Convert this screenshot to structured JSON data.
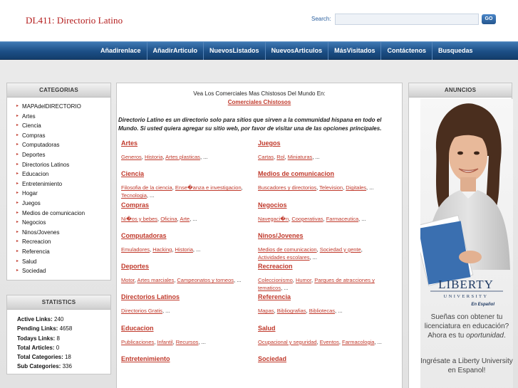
{
  "header": {
    "site_title": "DL411: Directorio Latino",
    "search_label": "Search:",
    "search_value": "",
    "search_button": "GO"
  },
  "nav": {
    "items": [
      "Añadirenlace",
      "AñadirArticulo",
      "NuevosListados",
      "NuevosArticulos",
      "MásVisitados",
      "Contáctenos",
      "Busquedas"
    ]
  },
  "categories": {
    "title": "CATEGORIAS",
    "items": [
      "MAPAdelDIRECTORIO",
      "Artes",
      "Ciencia",
      "Compras",
      "Computadoras",
      "Deportes",
      "Directorios Latinos",
      "Educacion",
      "Entretenimiento",
      "Hogar",
      "Juegos",
      "Medios de comunicacion",
      "Negocios",
      "Ninos/Jovenes",
      "Recreacion",
      "Referencia",
      "Salud",
      "Sociedad"
    ]
  },
  "statistics": {
    "title": "STATISTICS",
    "items": [
      {
        "label": "Active Links:",
        "value": "240"
      },
      {
        "label": "Pending Links:",
        "value": "4658"
      },
      {
        "label": "Todays Links:",
        "value": "8"
      },
      {
        "label": "Total Articles:",
        "value": "0"
      },
      {
        "label": "Total Categories:",
        "value": "18"
      },
      {
        "label": "Sub Categories:",
        "value": "336"
      }
    ]
  },
  "ads": {
    "title": "ANUNCIOS",
    "brand": "LIBERTY",
    "brand_sub": "UNIVERSITY",
    "brand_lang": "En Español",
    "copy_1": "Sueñas con obtener tu licenciatura en educación? Ahora es tu",
    "copy_1_em": "oportunidad",
    "copy_1_end": ".",
    "copy_2": "Ingrésate a Liberty University en Espanol!"
  },
  "main": {
    "promo_line": "Vea Los Comerciales Mas Chistosos Del Mundo En:",
    "promo_link": "Comerciales Chistosos",
    "intro": "Directorio Latino es un directorio solo para sitios que sirven a la communidad hispana en todo el Mundo. Si usted quiera agregar su sitio web, por favor de visitar una de las opciones principales.",
    "left": [
      {
        "title": "Artes",
        "subs": [
          "Generos",
          "Historia",
          "Artes plasticas"
        ],
        "more": "..."
      },
      {
        "title": "Ciencia",
        "subs": [
          "Filosofia de la ciencia",
          "Ense�anza e investigacion",
          "Tecnologia"
        ],
        "more": "..."
      },
      {
        "title": "Compras",
        "subs": [
          "Ni�os y bebes",
          "Oficina",
          "Arte"
        ],
        "more": "..."
      },
      {
        "title": "Computadoras",
        "subs": [
          "Emuladores",
          "Hacking",
          "Historia"
        ],
        "more": "..."
      },
      {
        "title": "Deportes",
        "subs": [
          "Motor",
          "Artes marciales",
          "Campeonatos y torneos"
        ],
        "more": "..."
      },
      {
        "title": "Directorios Latinos",
        "subs": [
          "Directorios Gratis"
        ],
        "more": "..."
      },
      {
        "title": "Educacion",
        "subs": [
          "Publicaciones",
          "Infantil",
          "Recursos"
        ],
        "more": "..."
      },
      {
        "title": "Entretenimiento",
        "subs": [],
        "more": ""
      }
    ],
    "right": [
      {
        "title": "Juegos",
        "subs": [
          "Cartas",
          "Rol",
          "Miniaturas"
        ],
        "more": "..."
      },
      {
        "title": "Medios de comunicacion",
        "subs": [
          "Buscadores y directorios",
          "Television",
          "Digitales"
        ],
        "more": "..."
      },
      {
        "title": "Negocios",
        "subs": [
          "Navegaci�n",
          "Cooperativas",
          "Farmaceutica"
        ],
        "more": "..."
      },
      {
        "title": "Ninos/Jovenes",
        "subs": [
          "Medios de comunicacion",
          "Sociedad y gente",
          "Actividades escolares"
        ],
        "more": "..."
      },
      {
        "title": "Recreacion",
        "subs": [
          "Coleccionismo",
          "Humor",
          "Parques de atracciones y tematicos"
        ],
        "more": "..."
      },
      {
        "title": "Referencia",
        "subs": [
          "Mapas",
          "Bibliografias",
          "Bibliotecas"
        ],
        "more": "..."
      },
      {
        "title": "Salud",
        "subs": [
          "Ocupacional y seguridad",
          "Eventos",
          "Farmacologia"
        ],
        "more": "..."
      },
      {
        "title": "Sociedad",
        "subs": [],
        "more": ""
      }
    ]
  },
  "colors": {
    "accent": "#c0392b",
    "nav": "#1c4f86",
    "title": "#b31b1b"
  }
}
